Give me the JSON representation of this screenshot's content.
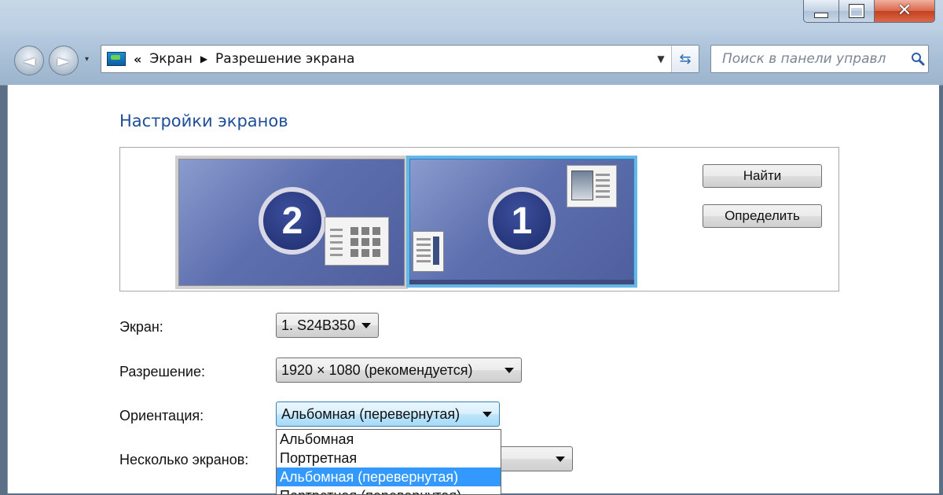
{
  "window": {
    "controls": {
      "minimize_icon": "minimize-icon",
      "maximize_icon": "maximize-icon",
      "close_icon": "close-icon"
    }
  },
  "toolbar": {
    "back_arrow": "◄",
    "forward_arrow": "►",
    "history_arrow": "▾"
  },
  "address_bar": {
    "icon": "display-icon",
    "chevron": "«",
    "crumbs": [
      "Экран",
      "Разрешение экрана"
    ],
    "separator": "▶",
    "dropdown_arrow": "▼",
    "refresh_icon": "⇆"
  },
  "search": {
    "placeholder": "Поиск в панели управл",
    "icon": "search-icon"
  },
  "main": {
    "title": "Настройки экранов",
    "monitors": [
      {
        "number": "2",
        "selected": false
      },
      {
        "number": "1",
        "selected": true
      }
    ],
    "buttons": {
      "find": "Найти",
      "identify": "Определить"
    }
  },
  "settings": {
    "screen": {
      "label": "Экран:",
      "value": "1. S24B350"
    },
    "resolution": {
      "label": "Разрешение:",
      "value": "1920 × 1080 (рекомендуется)"
    },
    "orientation": {
      "label": "Ориентация:",
      "value": "Альбомная (перевернутая)",
      "options": [
        "Альбомная",
        "Портретная",
        "Альбомная (перевернутая)",
        "Портретная (перевернутая)"
      ],
      "selected_index": 2
    },
    "multiple_displays": {
      "label": "Несколько экранов:",
      "value": ""
    }
  },
  "colors": {
    "title_blue": "#1e4e99",
    "selection_blue": "#3399ff",
    "monitor_blue": "#5d6fae",
    "selected_monitor_border": "#66b6e8"
  }
}
